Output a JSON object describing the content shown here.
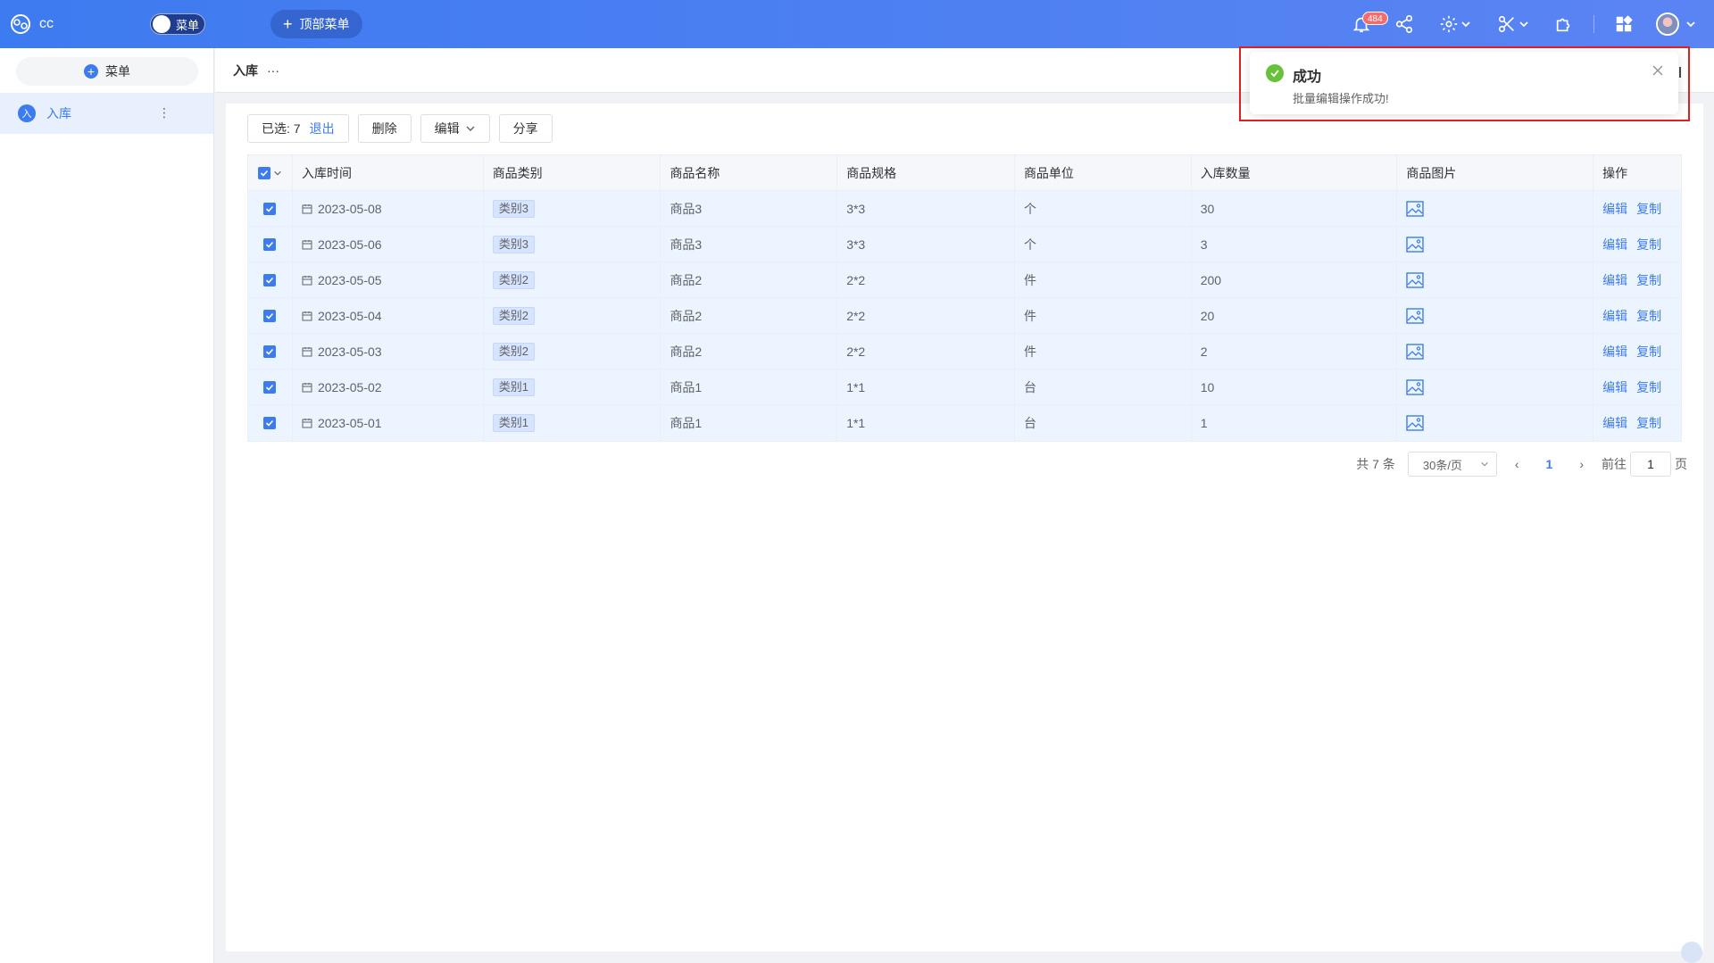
{
  "app": {
    "name": "cc",
    "menu_toggle_label": "菜单",
    "top_menu_label": "顶部菜单"
  },
  "topbar": {
    "notification_count": "484"
  },
  "sidebar": {
    "add_menu_label": "菜单",
    "items": [
      {
        "icon_letter": "入",
        "label": "入库"
      }
    ]
  },
  "breadcrumb": {
    "title": "入库",
    "more": "···"
  },
  "toolbar": {
    "selected_prefix": "已选: 7",
    "exit_label": "退出",
    "delete_label": "删除",
    "edit_label": "编辑",
    "share_label": "分享"
  },
  "table": {
    "headers": [
      "入库时间",
      "商品类别",
      "商品名称",
      "商品规格",
      "商品单位",
      "入库数量",
      "商品图片",
      "操作"
    ],
    "rows": [
      {
        "date": "2023-05-08",
        "category": "类别3",
        "name": "商品3",
        "spec": "3*3",
        "unit": "个",
        "qty": "30"
      },
      {
        "date": "2023-05-06",
        "category": "类别3",
        "name": "商品3",
        "spec": "3*3",
        "unit": "个",
        "qty": "3"
      },
      {
        "date": "2023-05-05",
        "category": "类别2",
        "name": "商品2",
        "spec": "2*2",
        "unit": "件",
        "qty": "200"
      },
      {
        "date": "2023-05-04",
        "category": "类别2",
        "name": "商品2",
        "spec": "2*2",
        "unit": "件",
        "qty": "20"
      },
      {
        "date": "2023-05-03",
        "category": "类别2",
        "name": "商品2",
        "spec": "2*2",
        "unit": "件",
        "qty": "2"
      },
      {
        "date": "2023-05-02",
        "category": "类别1",
        "name": "商品1",
        "spec": "1*1",
        "unit": "台",
        "qty": "10"
      },
      {
        "date": "2023-05-01",
        "category": "类别1",
        "name": "商品1",
        "spec": "1*1",
        "unit": "台",
        "qty": "1"
      }
    ],
    "row_actions": {
      "edit": "编辑",
      "copy": "复制"
    }
  },
  "pagination": {
    "total_label": "共 7 条",
    "page_size": "30条/页",
    "current_page": "1",
    "goto_label": "前往",
    "goto_value": "1",
    "page_suffix": "页"
  },
  "notification": {
    "title": "成功",
    "message": "批量编辑操作成功!"
  },
  "colors": {
    "primary": "#3d7bf0",
    "success": "#67c23a",
    "danger": "#f56c6c",
    "highlight_frame": "#e02020"
  }
}
